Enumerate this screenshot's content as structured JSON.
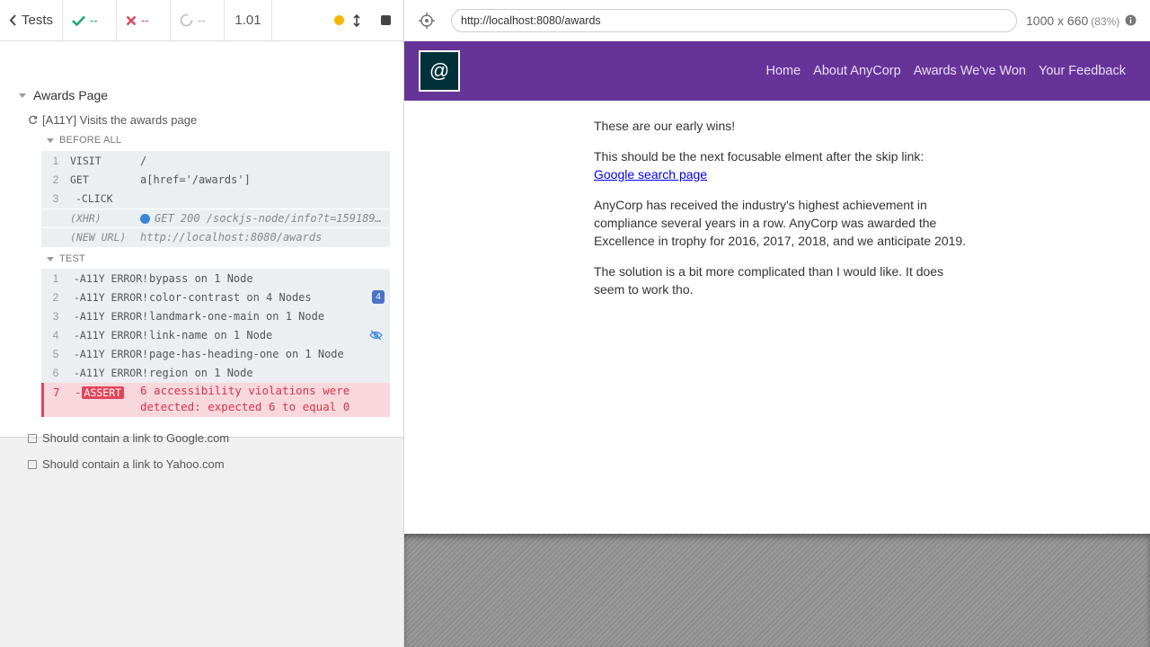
{
  "reporter": {
    "header": {
      "tests_label": "Tests",
      "passed": "--",
      "failed": "--",
      "pending": "--",
      "duration": "1.01"
    },
    "suite": {
      "title": "Awards Page",
      "test_title": "[A11Y] Visits the awards page",
      "before_all_label": "BEFORE ALL",
      "before_all": [
        {
          "num": "1",
          "name": "VISIT",
          "msg": "/"
        },
        {
          "num": "2",
          "name": "GET",
          "msg": "a[href='/awards']"
        },
        {
          "num": "3",
          "name": "-CLICK",
          "msg": ""
        },
        {
          "num": "",
          "name": "(XHR)",
          "msg": "GET 200 /sockjs-node/info?t=159189..."
        },
        {
          "num": "",
          "name": "(NEW URL)",
          "msg": "http://localhost:8080/awards"
        }
      ],
      "test_label": "TEST",
      "test_cmds": [
        {
          "num": "1",
          "name": "-A11Y ERROR!",
          "msg": "bypass on 1 Node"
        },
        {
          "num": "2",
          "name": "-A11Y ERROR!",
          "msg": "color-contrast on 4 Nodes",
          "badge": "4"
        },
        {
          "num": "3",
          "name": "-A11Y ERROR!",
          "msg": "landmark-one-main on 1 Node"
        },
        {
          "num": "4",
          "name": "-A11Y ERROR!",
          "msg": "link-name on 1 Node"
        },
        {
          "num": "5",
          "name": "-A11Y ERROR!",
          "msg": "page-has-heading-one on 1 Node"
        },
        {
          "num": "6",
          "name": "-A11Y ERROR!",
          "msg": "region on 1 Node"
        }
      ],
      "assert": {
        "num": "7",
        "tag": "ASSERT",
        "line1": "6 accessibility violations were",
        "line2": "detected: expected 6 to equal 0"
      },
      "other_tests": [
        "Should contain a link to Google.com",
        "Should contain a link to Yahoo.com"
      ]
    }
  },
  "browser": {
    "url": "http://localhost:8080/awards",
    "viewport": "1000 x 660",
    "zoom": "(83%)"
  },
  "aut": {
    "logo": "@",
    "nav": [
      "Home",
      "About AnyCorp",
      "Awards We've Won",
      "Your Feedback"
    ],
    "p1": "These are our early wins!",
    "p2": "This should be the next focusable elment after the skip link:",
    "p2_link": "Google search page",
    "p3": "AnyCorp has received the industry's highest achievement in compliance several years in a row. AnyCorp was awarded the Excellence in trophy for 2016, 2017, 2018, and we anticipate 2019.",
    "p4": "The solution is a bit more complicated than I would like. It does seem to work tho."
  },
  "colors": {
    "nav_bg": "#663399",
    "logo_bg": "#00313a",
    "error_red": "#e0455a",
    "passed_green": "#1fa971",
    "xhr_blue": "#3b87d7"
  }
}
